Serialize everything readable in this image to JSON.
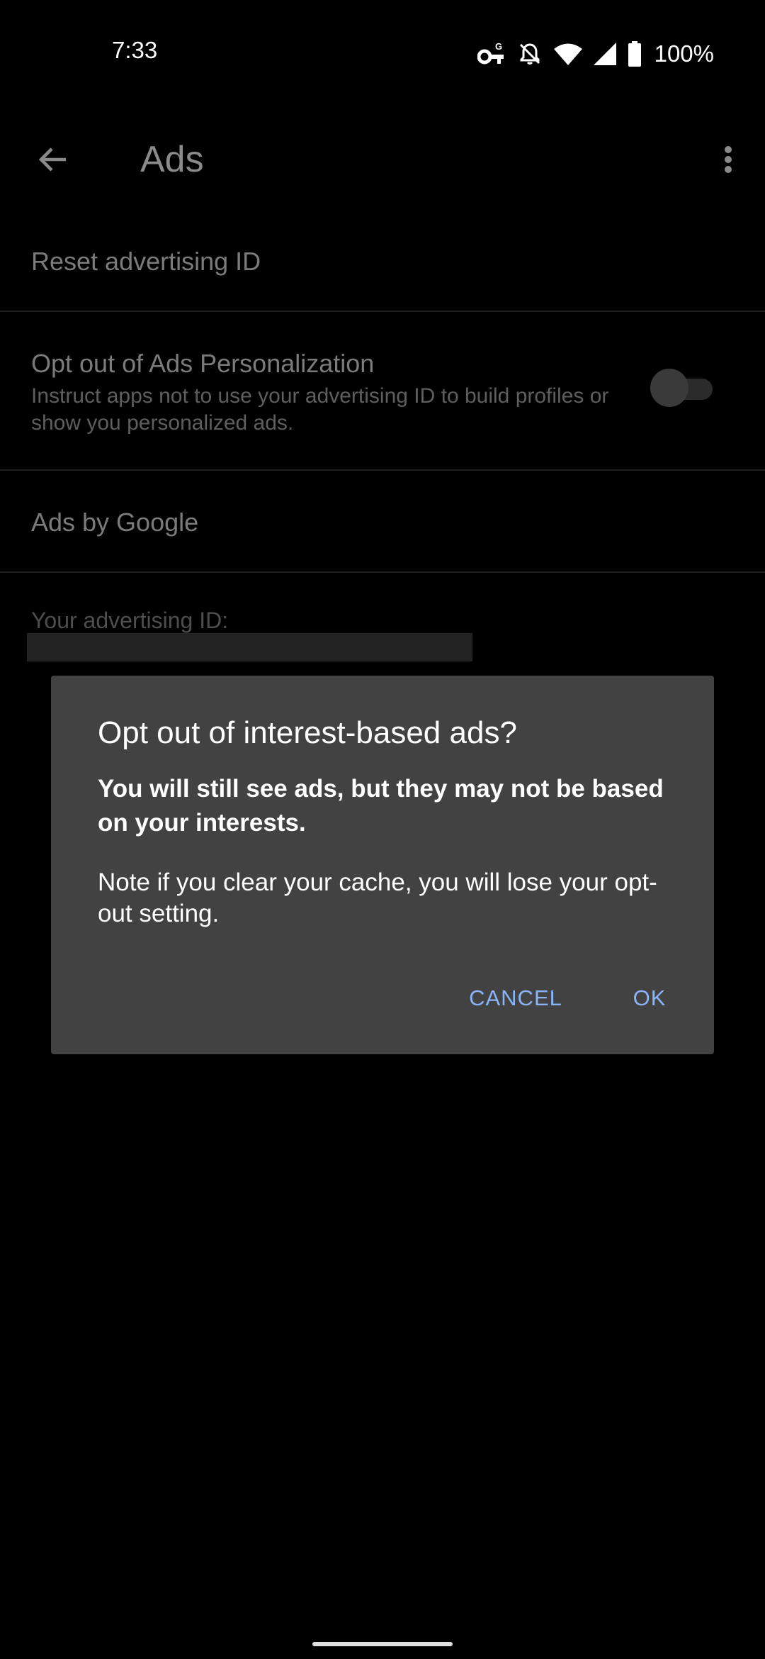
{
  "status_bar": {
    "time": "7:33",
    "battery": "100%",
    "icons": [
      "vpn-key-icon",
      "notifications-off-icon",
      "wifi-icon",
      "cellular-signal-icon",
      "battery-icon"
    ]
  },
  "app_bar": {
    "title": "Ads",
    "back_icon": "arrow-back-icon",
    "overflow_icon": "more-vert-icon"
  },
  "preferences": {
    "reset": {
      "title": "Reset advertising ID"
    },
    "opt_out": {
      "title": "Opt out of Ads Personalization",
      "summary": "Instruct apps not to use your advertising ID to build profiles or show you personalized ads.",
      "enabled": false
    },
    "ads_by_google": {
      "title": "Ads by Google"
    },
    "advertising_id": {
      "label": "Your advertising ID:"
    }
  },
  "dialog": {
    "title": "Opt out of interest-based ads?",
    "bold_message": "You will still see ads, but they may not be based on your interests.",
    "note": "Note if you clear your cache, you will lose your opt-out setting.",
    "cancel_label": "CANCEL",
    "ok_label": "OK"
  },
  "colors": {
    "background": "#000000",
    "dialog_bg": "#424242",
    "button_accent": "#8ab4f8",
    "dim_text": "#7b7b7b"
  }
}
